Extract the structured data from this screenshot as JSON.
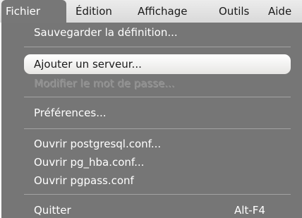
{
  "menubar": {
    "items": [
      {
        "label": "Fichier"
      },
      {
        "label": "Édition"
      },
      {
        "label": "Affichage"
      },
      {
        "label": "Outils"
      },
      {
        "label": "Aide"
      }
    ]
  },
  "menu": {
    "save_definition": "Sauvegarder la définition...",
    "add_server": "Ajouter un serveur...",
    "change_password": "Modifier le mot de passe...",
    "preferences": "Préférences...",
    "open_postgresql_conf": "Ouvrir postgresql.conf...",
    "open_pg_hba_conf": "Ouvrir pg_hba.conf...",
    "open_pgpass_conf": "Ouvrir pgpass.conf",
    "quit": "Quitter",
    "quit_shortcut": "Alt-F4"
  }
}
